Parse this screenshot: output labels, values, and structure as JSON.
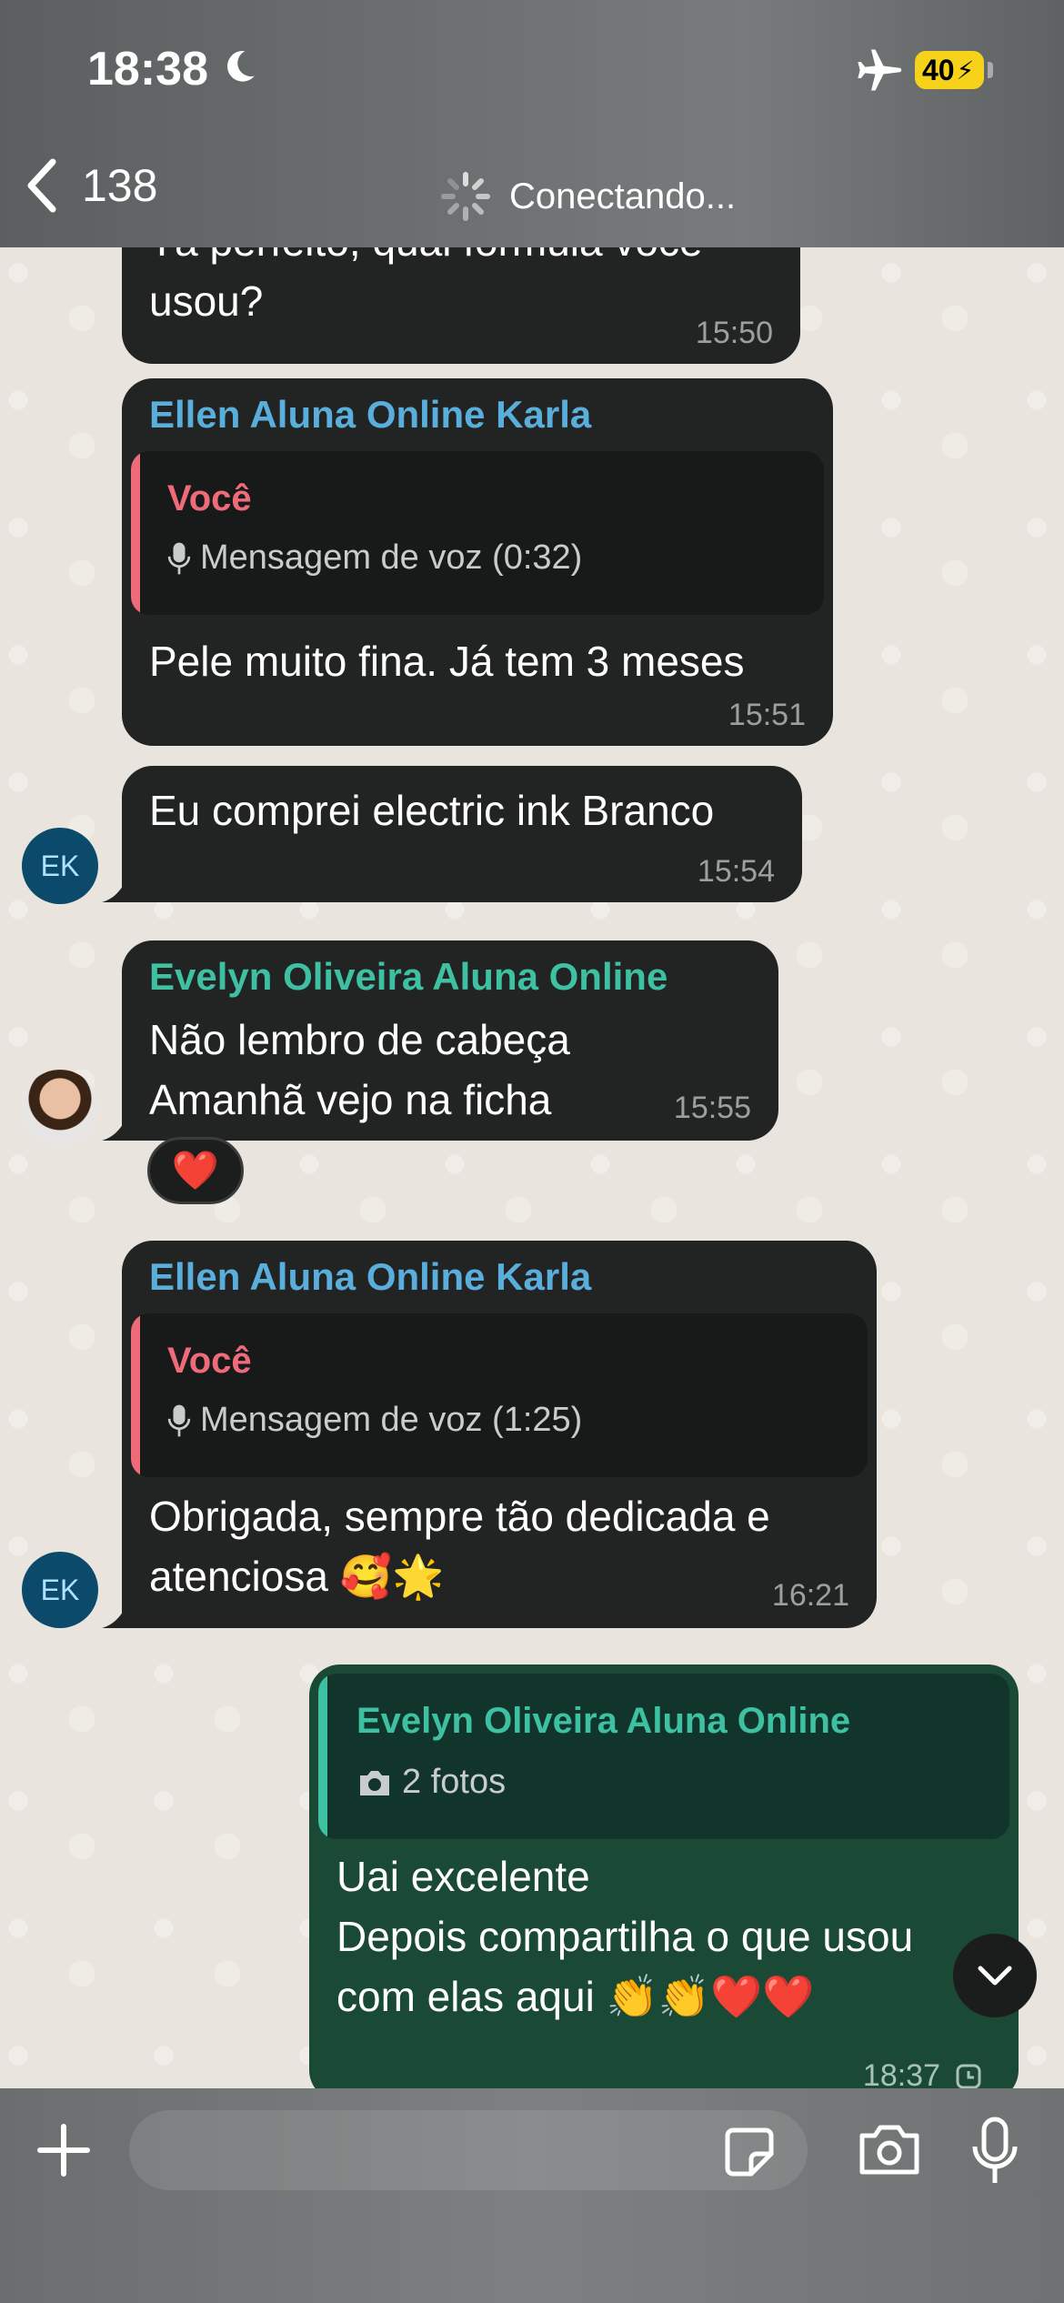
{
  "status": {
    "time": "18:38",
    "battery": "40"
  },
  "header": {
    "back_count": "138",
    "connecting_text": "Conectando..."
  },
  "messages": [
    {
      "text_lines": [
        "Tá perfeito, qual fórmula você",
        "usou?"
      ],
      "time": "15:50"
    },
    {
      "sender": "Ellen Aluna Online Karla",
      "quote_name": "Você",
      "quote_text": "Mensagem de voz (0:32)",
      "text": "Pele muito fina. Já tem 3 meses",
      "time": "15:51"
    },
    {
      "text": "Eu comprei electric ink Branco",
      "time": "15:54",
      "avatar": "EK"
    },
    {
      "sender": "Evelyn Oliveira Aluna Online",
      "text_lines": [
        "Não lembro de cabeça",
        "Amanhã vejo na ficha"
      ],
      "time": "15:55",
      "reaction": "❤️"
    },
    {
      "sender": "Ellen Aluna Online Karla",
      "quote_name": "Você",
      "quote_text": "Mensagem de voz (1:25)",
      "text_lines": [
        "Obrigada, sempre tão dedicada e",
        "atenciosa 🥰🌟"
      ],
      "time": "16:21",
      "avatar": "EK"
    },
    {
      "quote_name": "Evelyn Oliveira Aluna Online",
      "quote_text": "2 fotos",
      "text_lines": [
        "Uai excelente",
        "Depois compartilha o que usou",
        "com elas aqui 👏👏❤️❤️"
      ],
      "time": "18:37"
    }
  ],
  "colors": {
    "ellen": "#5aaedb",
    "evelyn": "#3ec0a2",
    "you": "#ef6b7a",
    "outgoing": "#1a4a36"
  }
}
